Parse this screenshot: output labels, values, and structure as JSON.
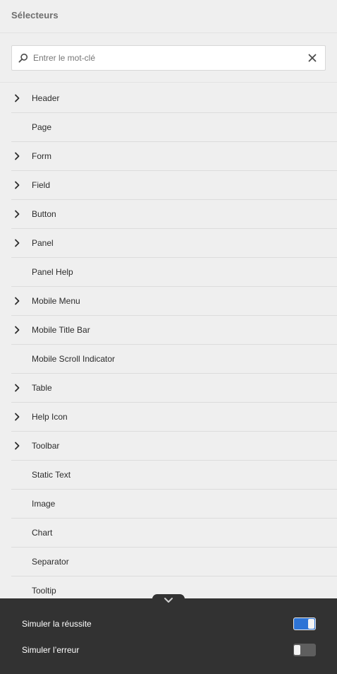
{
  "panel": {
    "title": "Sélecteurs"
  },
  "search": {
    "placeholder": "Entrer le mot-clé",
    "value": ""
  },
  "selectors": [
    {
      "label": "Header",
      "expandable": true
    },
    {
      "label": "Page",
      "expandable": false
    },
    {
      "label": "Form",
      "expandable": true
    },
    {
      "label": "Field",
      "expandable": true
    },
    {
      "label": "Button",
      "expandable": true
    },
    {
      "label": "Panel",
      "expandable": true
    },
    {
      "label": "Panel Help",
      "expandable": false
    },
    {
      "label": "Mobile Menu",
      "expandable": true
    },
    {
      "label": "Mobile Title Bar",
      "expandable": true
    },
    {
      "label": "Mobile Scroll Indicator",
      "expandable": false
    },
    {
      "label": "Table",
      "expandable": true
    },
    {
      "label": "Help Icon",
      "expandable": true
    },
    {
      "label": "Toolbar",
      "expandable": true
    },
    {
      "label": "Static Text",
      "expandable": false
    },
    {
      "label": "Image",
      "expandable": false
    },
    {
      "label": "Chart",
      "expandable": false
    },
    {
      "label": "Separator",
      "expandable": false
    },
    {
      "label": "Tooltip",
      "expandable": false
    }
  ],
  "footer": {
    "simulate_success": {
      "label": "Simuler la réussite",
      "on": true
    },
    "simulate_error": {
      "label": "Simuler l’erreur",
      "on": false
    }
  },
  "colors": {
    "toggle_on": "#2d74d6",
    "toggle_off": "#5e5e5e",
    "footer_bg": "#323232"
  },
  "icons": {
    "search": "search-icon",
    "clear": "close-icon",
    "expand": "chevron-right-icon",
    "collapse": "chevron-down-icon"
  }
}
